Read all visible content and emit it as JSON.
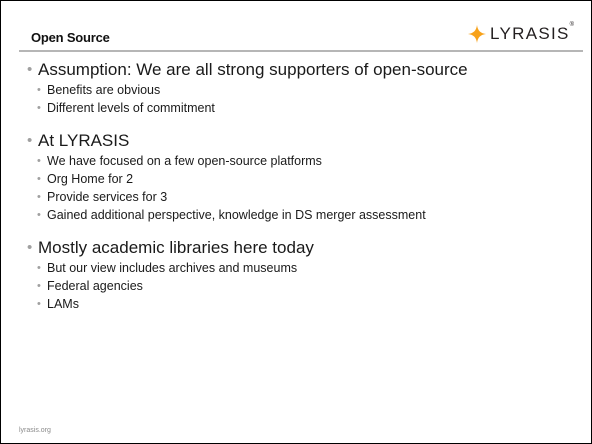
{
  "slide": {
    "title": "Open Source",
    "logo_text": "LYRASIS",
    "logo_mark": "®",
    "brand_color": "#f7a21b",
    "footer": "lyrasis.org"
  },
  "groups": [
    {
      "heading": "Assumption: We are all strong supporters of open-source",
      "items": [
        "Benefits are obvious",
        "Different levels of commitment"
      ]
    },
    {
      "heading": "At LYRASIS",
      "items": [
        "We have focused on a few open-source platforms",
        "Org Home for 2",
        "Provide services for 3",
        "Gained additional perspective, knowledge in DS merger assessment"
      ]
    },
    {
      "heading": "Mostly academic libraries here today",
      "items": [
        "But our view includes archives and museums",
        "Federal agencies",
        "LAMs"
      ]
    }
  ],
  "bullet_glyph": "•"
}
